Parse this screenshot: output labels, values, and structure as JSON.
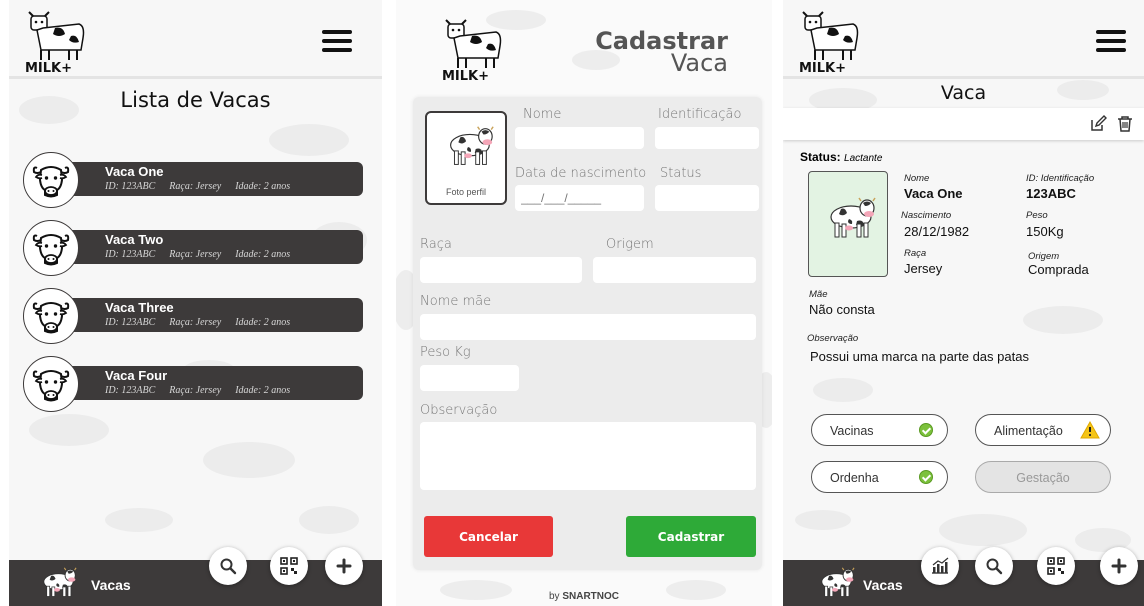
{
  "list_screen": {
    "title": "Lista de Vacas",
    "cows": [
      {
        "name": "Vaca One",
        "id": "ID: 123ABC",
        "breed": "Raça: Jersey",
        "age": "Idade: 2 anos"
      },
      {
        "name": "Vaca Two",
        "id": "ID: 123ABC",
        "breed": "Raça: Jersey",
        "age": "Idade: 2 anos"
      },
      {
        "name": "Vaca Three",
        "id": "ID: 123ABC",
        "breed": "Raça: Jersey",
        "age": "Idade: 2 anos"
      },
      {
        "name": "Vaca Four",
        "id": "ID: 123ABC",
        "breed": "Raça: Jersey",
        "age": "Idade: 2 anos"
      }
    ],
    "nav_label": "Vacas",
    "fabs": [
      "search-icon",
      "qr-code-icon",
      "plus-icon"
    ]
  },
  "form_screen": {
    "title_line1": "Cadastrar",
    "title_line2": "Vaca",
    "photo_caption": "Foto perfil",
    "fields": {
      "nome": "Nome",
      "identificacao": "Identificação",
      "nascimento": "Data de nascimento",
      "nascimento_placeholder": "___/___/_____",
      "status": "Status",
      "raca": "Raça",
      "origem": "Origem",
      "nome_mae": "Nome mãe",
      "peso": "Peso Kg",
      "observacao": "Observação"
    },
    "cancel_label": "Cancelar",
    "submit_label": "Cadastrar",
    "footer_prefix": "by ",
    "footer_brand": "SNARTNOC"
  },
  "detail_screen": {
    "title": "Vaca",
    "status_label": "Status:",
    "status_value": "Lactante",
    "labels": {
      "nome": "Nome",
      "id": "ID: Identificação",
      "nascimento": "Nascimento",
      "peso": "Peso",
      "raca": "Raça",
      "origem": "Origem",
      "mae": "Mãe",
      "observacao": "Observação"
    },
    "values": {
      "nome": "Vaca One",
      "id": "123ABC",
      "nascimento": "28/12/1982",
      "peso": "150Kg",
      "raca": "Jersey",
      "origem": "Comprada",
      "mae": "Não consta",
      "observacao": "Possui uma marca na parte das patas"
    },
    "buttons": {
      "vacinas": "Vacinas",
      "alimentacao": "Alimentação",
      "ordenha": "Ordenha",
      "gestacao": "Gestação"
    },
    "nav_label": "Vacas",
    "fabs": [
      "chart-icon",
      "search-icon",
      "qr-code-icon",
      "plus-icon"
    ]
  },
  "colors": {
    "dark": "#3d3a3a",
    "cancel": "#e83838",
    "submit": "#2eaa38",
    "check": "#7cc13c",
    "warning": "#f5c518"
  }
}
